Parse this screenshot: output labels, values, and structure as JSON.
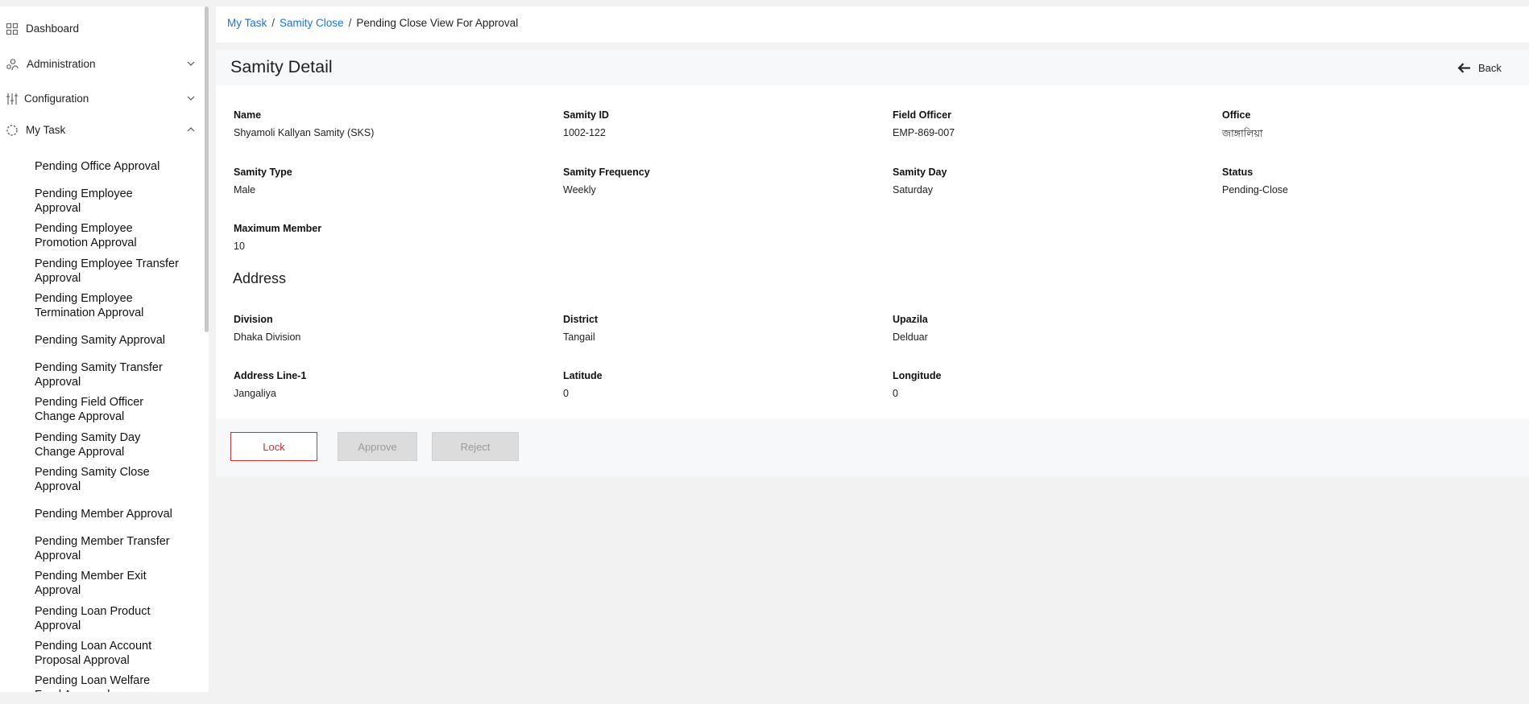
{
  "sidebar": {
    "top_items": [
      {
        "label": "Dashboard",
        "icon": "grid-icon"
      },
      {
        "label": "Administration",
        "icon": "users-icon",
        "expanded": false
      },
      {
        "label": "Configuration",
        "icon": "sliders-icon",
        "expanded": false
      },
      {
        "label": "My Task",
        "icon": "task-circle-icon",
        "expanded": true
      }
    ],
    "my_task_items": [
      "Pending Office Approval",
      "Pending Employee Approval",
      "Pending Employee Promotion Approval",
      "Pending Employee Transfer Approval",
      "Pending Employee Termination Approval",
      "Pending Samity Approval",
      "Pending Samity Transfer Approval",
      "Pending Field Officer Change Approval",
      "Pending Samity Day Change Approval",
      "Pending Samity Close Approval",
      "Pending Member Approval",
      "Pending Member Transfer Approval",
      "Pending Member Exit Approval",
      "Pending Loan Product Approval",
      "Pending Loan Account Proposal Approval",
      "Pending Loan Welfare Fund Approval"
    ]
  },
  "breadcrumb": {
    "items": [
      "My Task",
      "Samity Close",
      "Pending Close View For Approval"
    ],
    "separator": "/"
  },
  "detail": {
    "title": "Samity Detail",
    "back_label": "Back"
  },
  "samity": {
    "name": {
      "label": "Name",
      "value": "Shyamoli Kallyan Samity (SKS)"
    },
    "samity_id": {
      "label": "Samity ID",
      "value": "1002-122"
    },
    "field_officer": {
      "label": "Field Officer",
      "value": "EMP-869-007"
    },
    "office": {
      "label": "Office",
      "value": "জাঙ্গালিয়া"
    },
    "samity_type": {
      "label": "Samity Type",
      "value": "Male"
    },
    "frequency": {
      "label": "Samity Frequency",
      "value": "Weekly"
    },
    "samity_day": {
      "label": "Samity Day",
      "value": "Saturday"
    },
    "status": {
      "label": "Status",
      "value": "Pending-Close"
    },
    "max_member": {
      "label": "Maximum Member",
      "value": "10"
    }
  },
  "address": {
    "title": "Address",
    "division": {
      "label": "Division",
      "value": "Dhaka Division"
    },
    "district": {
      "label": "District",
      "value": "Tangail"
    },
    "upazila": {
      "label": "Upazila",
      "value": "Delduar"
    },
    "line1": {
      "label": "Address Line-1",
      "value": "Jangaliya"
    },
    "latitude": {
      "label": "Latitude",
      "value": "0"
    },
    "longitude": {
      "label": "Longitude",
      "value": "0"
    }
  },
  "actions": {
    "lock": "Lock",
    "approve": "Approve",
    "reject": "Reject"
  },
  "colors": {
    "link": "#1a73e8",
    "danger": "#d32f2f",
    "disabled_bg": "#dcdcdc"
  }
}
